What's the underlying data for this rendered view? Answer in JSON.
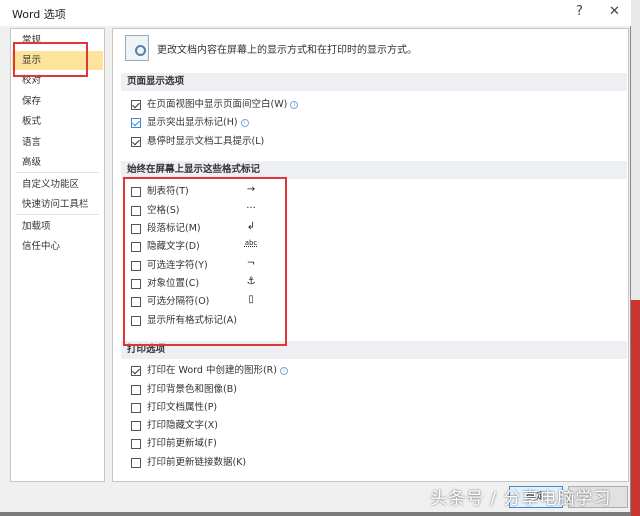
{
  "window": {
    "title": "Word 选项",
    "help": "?",
    "close": "✕"
  },
  "nav": {
    "items": [
      {
        "label": "常规"
      },
      {
        "label": "显示"
      },
      {
        "label": "校对"
      },
      {
        "label": "保存"
      },
      {
        "label": "板式"
      },
      {
        "label": "语言"
      },
      {
        "label": "高级"
      },
      {
        "label": "自定义功能区"
      },
      {
        "label": "快速访问工具栏"
      },
      {
        "label": "加载项"
      },
      {
        "label": "信任中心"
      }
    ],
    "selected": "显示"
  },
  "main": {
    "header": "更改文档内容在屏幕上的显示方式和在打印时的显示方式。",
    "sections": [
      {
        "title": "页面显示选项",
        "options": [
          {
            "label": "在页面视图中显示页面间空白(W)",
            "checked": true,
            "info": "ⓘ"
          },
          {
            "label": "显示突出显示标记(H)",
            "checked": true,
            "info": "ⓘ"
          },
          {
            "label": "悬停时显示文档工具提示(L)",
            "checked": true
          }
        ]
      },
      {
        "title": "始终在屏幕上显示这些格式标记",
        "options": [
          {
            "label": "制表符(T)",
            "checked": false,
            "mark": "→"
          },
          {
            "label": "空格(S)",
            "checked": false,
            "mark": "···"
          },
          {
            "label": "段落标记(M)",
            "checked": false,
            "mark": "↲"
          },
          {
            "label": "隐藏文字(D)",
            "checked": false,
            "mark": "abc"
          },
          {
            "label": "可选连字符(Y)",
            "checked": false,
            "mark": "¬"
          },
          {
            "label": "对象位置(C)",
            "checked": false,
            "mark": "⚓"
          },
          {
            "label": "可选分隔符(O)",
            "checked": false,
            "mark": "▯"
          },
          {
            "label": "显示所有格式标记(A)",
            "checked": false
          }
        ]
      },
      {
        "title": "打印选项",
        "options": [
          {
            "label": "打印在 Word 中创建的图形(R)",
            "checked": true,
            "info": "ⓘ"
          },
          {
            "label": "打印背景色和图像(B)",
            "checked": false
          },
          {
            "label": "打印文档属性(P)",
            "checked": false
          },
          {
            "label": "打印隐藏文字(X)",
            "checked": false
          },
          {
            "label": "打印前更新域(F)",
            "checked": false
          },
          {
            "label": "打印前更新链接数据(K)",
            "checked": false
          }
        ]
      }
    ]
  },
  "footer": {
    "ok": "确定"
  },
  "watermark": "头条号 / 分享电脑学习"
}
